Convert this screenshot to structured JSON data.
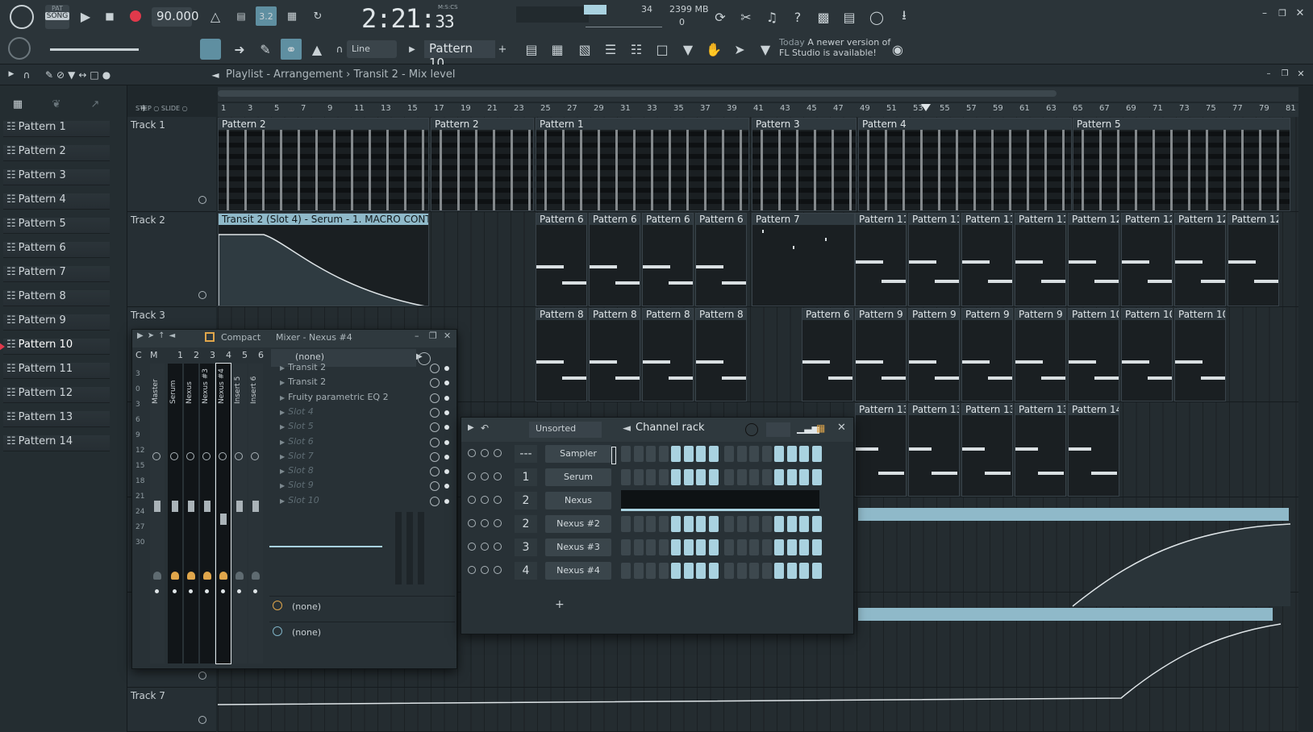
{
  "toolbar": {
    "pat_label": "PAT",
    "song_label": "SONG",
    "tempo": "90.000",
    "time_main": "2:21",
    "time_sec": "33",
    "time_label": "M:S:CS",
    "cpu_value": "34",
    "memory": "2399 MB",
    "polyphony": "0",
    "snap_mode": "Line",
    "pattern_selector": "Pattern 10",
    "news_date": "Today",
    "news_text": "A newer version of",
    "news_text2": "FL Studio is available!"
  },
  "playlist": {
    "breadcrumb": "Playlist - Arrangement",
    "breadcrumb_sep": "›",
    "breadcrumb2": "Transit 2 - Mix level",
    "step_label": "STEP",
    "slide_label": "SLIDE",
    "ruler": [
      "1",
      "3",
      "5",
      "7",
      "9",
      "11",
      "13",
      "15",
      "17",
      "19",
      "21",
      "23",
      "25",
      "27",
      "29",
      "31",
      "33",
      "35",
      "37",
      "39",
      "41",
      "43",
      "45",
      "47",
      "49",
      "51",
      "53",
      "55",
      "57",
      "59",
      "61",
      "63",
      "65",
      "67",
      "69",
      "71",
      "73",
      "75",
      "77",
      "79",
      "81"
    ],
    "tracks": [
      "Track 1",
      "Track 2",
      "Track 3",
      "Track 7"
    ],
    "track1_clips": [
      "Pattern 2",
      "Pattern 2",
      "Pattern 1",
      "Pattern 3",
      "Pattern 4",
      "Pattern 5"
    ],
    "track2_automation": "Transit 2 (Slot 4) - Serum - 1. MACRO CONTROL",
    "track2_clips": [
      "Pattern 6",
      "Pattern 6",
      "Pattern 6",
      "Pattern 6",
      "Pattern 7",
      "Pattern 11",
      "Pattern 11",
      "Pattern 11",
      "Pattern 11",
      "Pattern 12",
      "Pattern 12",
      "Pattern 12",
      "Pattern 12"
    ],
    "track3_clips": [
      "Pattern 8",
      "Pattern 8",
      "Pattern 8",
      "Pattern 8",
      "Pattern 6",
      "Pattern 9",
      "Pattern 9",
      "Pattern 9",
      "Pattern 9",
      "Pattern 10",
      "Pattern 10",
      "Pattern 10"
    ],
    "track4_clips": [
      "Pattern 13",
      "Pattern 13",
      "Pattern 13",
      "Pattern 13",
      "Pattern 14"
    ]
  },
  "picker": {
    "patterns": [
      "Pattern 1",
      "Pattern 2",
      "Pattern 3",
      "Pattern 4",
      "Pattern 5",
      "Pattern 6",
      "Pattern 7",
      "Pattern 8",
      "Pattern 9",
      "Pattern 10",
      "Pattern 11",
      "Pattern 12",
      "Pattern 13",
      "Pattern 14"
    ],
    "selected_index": 9
  },
  "mixer": {
    "mode": "Compact",
    "title": "Mixer - Nexus #4",
    "col_c": "C",
    "col_m": "M",
    "nums": [
      "1",
      "2",
      "3",
      "4",
      "5",
      "6"
    ],
    "scale": [
      "3",
      "0",
      "3",
      "6",
      "9",
      "12",
      "15",
      "18",
      "21",
      "24",
      "27",
      "30"
    ],
    "strips": [
      "Master",
      "Serum",
      "Nexus",
      "Nexus #3",
      "Nexus #4",
      "Insert 5",
      "Insert 6"
    ],
    "input": "(none)",
    "slots": [
      {
        "name": "Transit 2",
        "empty": false
      },
      {
        "name": "Transit 2",
        "empty": false
      },
      {
        "name": "Fruity parametric EQ 2",
        "empty": false
      },
      {
        "name": "Slot 4",
        "empty": true
      },
      {
        "name": "Slot 5",
        "empty": true
      },
      {
        "name": "Slot 6",
        "empty": true
      },
      {
        "name": "Slot 7",
        "empty": true
      },
      {
        "name": "Slot 8",
        "empty": true
      },
      {
        "name": "Slot 9",
        "empty": true
      },
      {
        "name": "Slot 10",
        "empty": true
      }
    ],
    "out1": "(none)",
    "out2": "(none)"
  },
  "rack": {
    "filter": "Unsorted",
    "title": "Channel rack",
    "channels": [
      {
        "num": "---",
        "name": "Sampler",
        "steps": [
          0,
          0,
          0,
          0,
          1,
          1,
          1,
          1,
          0,
          0,
          0,
          0,
          1,
          1,
          1,
          1
        ]
      },
      {
        "num": "1",
        "name": "Serum",
        "steps": [
          0,
          0,
          0,
          0,
          1,
          1,
          1,
          1,
          0,
          0,
          0,
          0,
          1,
          1,
          1,
          1
        ]
      },
      {
        "num": "2",
        "name": "Nexus",
        "steps": null
      },
      {
        "num": "2",
        "name": "Nexus #2",
        "steps": [
          0,
          0,
          0,
          0,
          1,
          1,
          1,
          1,
          0,
          0,
          0,
          0,
          1,
          1,
          1,
          1
        ]
      },
      {
        "num": "3",
        "name": "Nexus #3",
        "steps": [
          0,
          0,
          0,
          0,
          1,
          1,
          1,
          1,
          0,
          0,
          0,
          0,
          1,
          1,
          1,
          1
        ]
      },
      {
        "num": "4",
        "name": "Nexus #4",
        "steps": [
          0,
          0,
          0,
          0,
          1,
          1,
          1,
          1,
          0,
          0,
          0,
          0,
          1,
          1,
          1,
          1
        ]
      }
    ],
    "add_label": "+"
  },
  "colors": {
    "accent": "#a9d2e0",
    "record": "#e0394b",
    "bg": "#1f272b"
  }
}
